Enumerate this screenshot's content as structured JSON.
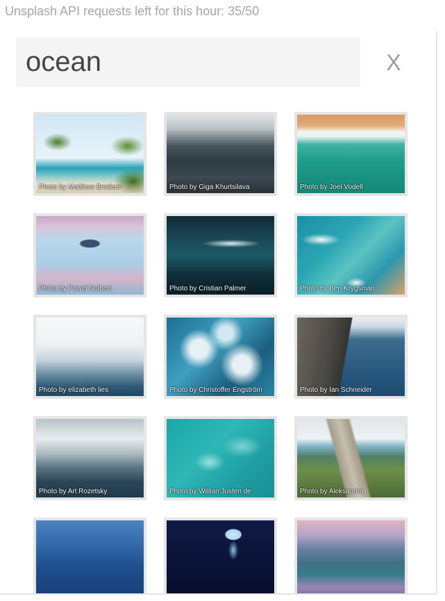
{
  "api_status": "Unsplash API requests left for this hour: 35/50",
  "search": {
    "value": "ocean",
    "close_label": "X"
  },
  "photos": [
    {
      "credit": "Photo by Matthew Brodeur"
    },
    {
      "credit": "Photo by Giga Khurtsilava"
    },
    {
      "credit": "Photo by Joel Vodell"
    },
    {
      "credit": "Photo by Pawel Nolbert"
    },
    {
      "credit": "Photo by Cristian Palmer"
    },
    {
      "credit": "Photo by Ben Krygsman"
    },
    {
      "credit": "Photo by elizabeth lies"
    },
    {
      "credit": "Photo by Christoffer Engström"
    },
    {
      "credit": "Photo by Ian Schneider"
    },
    {
      "credit": "Photo by Art Rozetsky"
    },
    {
      "credit": "Photo by Willian Justen de"
    },
    {
      "credit": "Photo by Aleksandra"
    },
    {
      "credit": ""
    },
    {
      "credit": ""
    },
    {
      "credit": ""
    }
  ]
}
